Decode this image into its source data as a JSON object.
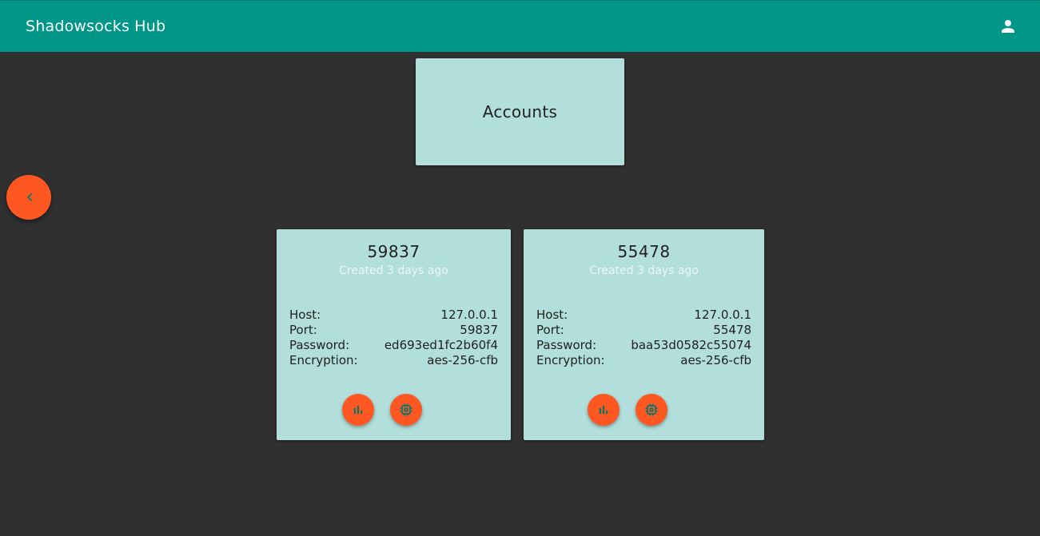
{
  "toolbar": {
    "title": "Shadowsocks Hub",
    "account_icon": "person-icon"
  },
  "header_card": {
    "title": "Accounts"
  },
  "back_button": {
    "icon": "chevron-left-icon"
  },
  "colors": {
    "primary": "#009688",
    "card_bg": "#b2dfdb",
    "accent": "#ff5722",
    "background": "#303030"
  },
  "accounts": [
    {
      "title": "59837",
      "subtitle": "Created 3 days ago",
      "details": [
        {
          "label": "Host:",
          "value": "127.0.0.1"
        },
        {
          "label": "Port:",
          "value": "59837"
        },
        {
          "label": "Password:",
          "value": "ed693ed1fc2b60f4"
        },
        {
          "label": "Encryption:",
          "value": "aes-256-cfb"
        }
      ],
      "actions": [
        "bar-chart-icon",
        "memory-chip-icon"
      ]
    },
    {
      "title": "55478",
      "subtitle": "Created 3 days ago",
      "details": [
        {
          "label": "Host:",
          "value": "127.0.0.1"
        },
        {
          "label": "Port:",
          "value": "55478"
        },
        {
          "label": "Password:",
          "value": "baa53d0582c55074"
        },
        {
          "label": "Encryption:",
          "value": "aes-256-cfb"
        }
      ],
      "actions": [
        "bar-chart-icon",
        "memory-chip-icon"
      ]
    }
  ]
}
